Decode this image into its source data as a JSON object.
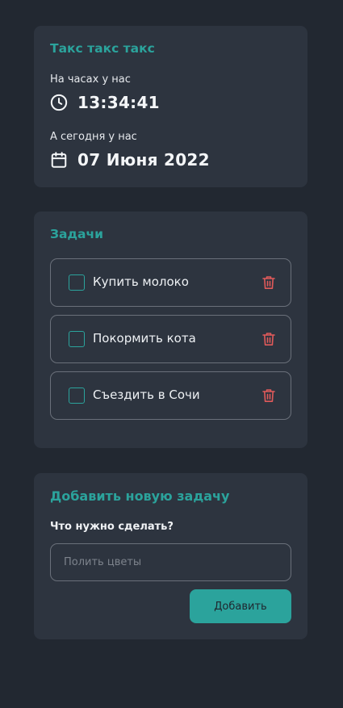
{
  "clock_card": {
    "title": "Такс такс такс",
    "time_label": "На часах у нас",
    "time_value": "13:34:41",
    "time_icon": "clock-icon",
    "date_label": "А сегодня у нас",
    "date_value": "07 Июня 2022",
    "date_icon": "calendar-icon"
  },
  "tasks_card": {
    "title": "Задачи",
    "items": [
      {
        "label": "Купить молоко",
        "done": false
      },
      {
        "label": "Покормить кота",
        "done": false
      },
      {
        "label": "Съездить в Сочи",
        "done": false
      }
    ],
    "delete_icon": "trash-icon"
  },
  "add_card": {
    "title": "Добавить новую задачу",
    "field_label": "Что нужно сделать?",
    "input_placeholder": "Полить цветы",
    "input_value": "",
    "button_label": "Добавить"
  },
  "colors": {
    "background": "#222831",
    "card": "#2d343f",
    "accent": "#2ba39c",
    "danger": "#e05a5a",
    "border": "#6a707a"
  }
}
